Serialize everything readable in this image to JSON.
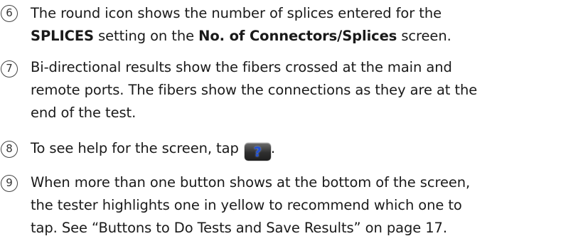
{
  "items": [
    {
      "number": "6",
      "lines": [
        {
          "parts": [
            "The round icon shows the number of splices entered for the"
          ]
        },
        {
          "parts": [
            "SPLICES",
            " setting on the ",
            "No. of Connectors/Splices",
            " screen."
          ]
        }
      ]
    },
    {
      "number": "7",
      "lines": [
        "Bi-directional results show the fibers crossed at the main and",
        "remote ports. The fibers show the connections as they are at the",
        "end of the test."
      ]
    },
    {
      "number": "8",
      "text_before": "To see help for the screen, tap ",
      "icon": "help-question-icon",
      "icon_glyph": "?",
      "text_after": "."
    },
    {
      "number": "9",
      "lines": [
        "When more than one button shows at the bottom of the screen,",
        "the tester highlights one in yellow to recommend which one to",
        "tap. See “Buttons to Do Tests and Save Results” on page 17."
      ]
    }
  ]
}
